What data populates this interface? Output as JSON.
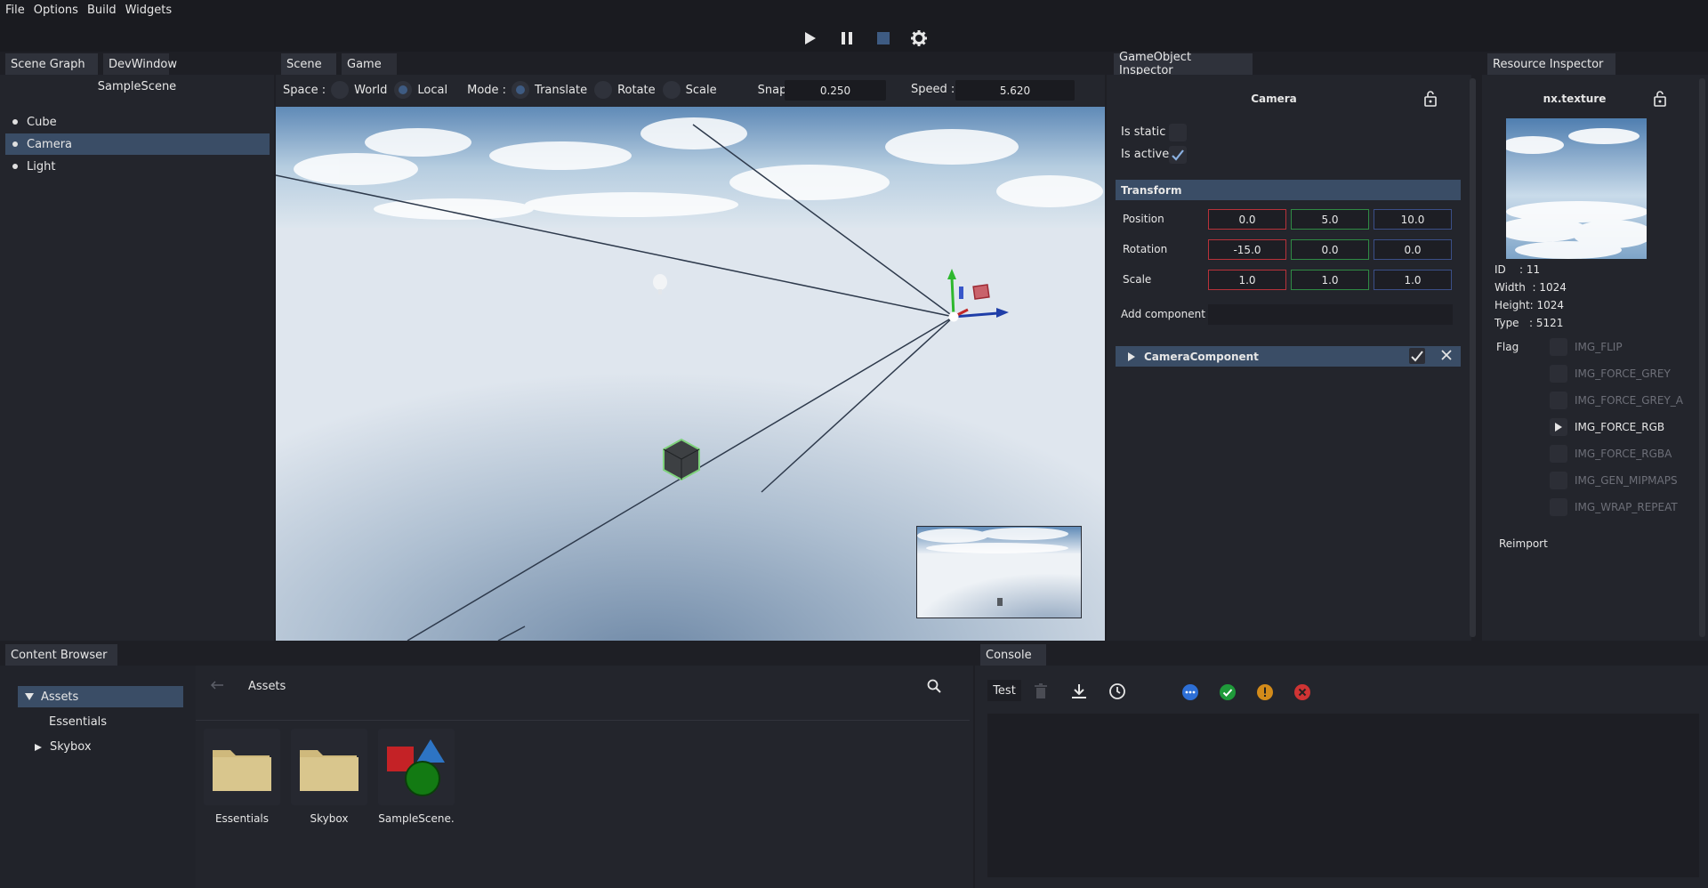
{
  "menu": [
    "File",
    "Options",
    "Build",
    "Widgets"
  ],
  "toolbar": {
    "play": "play-icon",
    "pause": "pause-icon",
    "stop": "stop-icon",
    "settings": "gear-icon"
  },
  "left_tabs": [
    "Scene Graph",
    "DevWindow"
  ],
  "scene": {
    "name": "SampleScene",
    "items": [
      {
        "label": "Cube",
        "selected": false
      },
      {
        "label": "Camera",
        "selected": true
      },
      {
        "label": "Light",
        "selected": false
      }
    ]
  },
  "viewport_tabs": [
    "Scene",
    "Game"
  ],
  "viewport_toolbar": {
    "space_label": "Space :",
    "world": "World",
    "local": "Local",
    "mode_label": "Mode :",
    "translate": "Translate",
    "rotate": "Rotate",
    "scale": "Scale",
    "snap_label": "Snap :",
    "snap_value": "0.250",
    "speed_label": "Speed :",
    "speed_value": "5.620"
  },
  "inspector": {
    "tab": "GameObject Inspector",
    "object_name": "Camera",
    "is_static_label": "Is static",
    "is_static": false,
    "is_active_label": "Is active",
    "is_active": true,
    "transform_label": "Transform",
    "position_label": "Position",
    "position": [
      "0.0",
      "5.0",
      "10.0"
    ],
    "rotation_label": "Rotation",
    "rotation": [
      "-15.0",
      "0.0",
      "0.0"
    ],
    "scale_label": "Scale",
    "scale": [
      "1.0",
      "1.0",
      "1.0"
    ],
    "add_component_label": "Add component",
    "component_name": "CameraComponent"
  },
  "resource": {
    "tab": "Resource Inspector",
    "name": "nx.texture",
    "id_label": "ID",
    "id": ": 11",
    "width_label": "Width",
    "width": ": 1024",
    "height_label": "Height",
    "height": ": 1024",
    "type_label": "Type",
    "type": ": 5121",
    "flag_label": "Flag",
    "flags": [
      {
        "label": "IMG_FLIP",
        "active": false
      },
      {
        "label": "IMG_FORCE_GREY",
        "active": false
      },
      {
        "label": "IMG_FORCE_GREY_A",
        "active": false
      },
      {
        "label": "IMG_FORCE_RGB",
        "active": true
      },
      {
        "label": "IMG_FORCE_RGBA",
        "active": false
      },
      {
        "label": "IMG_GEN_MIPMAPS",
        "active": false
      },
      {
        "label": "IMG_WRAP_REPEAT",
        "active": false
      }
    ],
    "reimport_label": "Reimport"
  },
  "content_browser": {
    "tab": "Content Browser",
    "tree": [
      "Assets",
      "Essentials",
      "Skybox"
    ],
    "path": "Assets",
    "assets": [
      "Essentials",
      "Skybox",
      "SampleScene."
    ]
  },
  "console": {
    "tab": "Console",
    "filter_text": "Test"
  },
  "colors": {
    "accent": "#3a4d66",
    "x_axis": "#b8323a",
    "y_axis": "#2f8a44",
    "z_axis": "#3b4f88"
  }
}
